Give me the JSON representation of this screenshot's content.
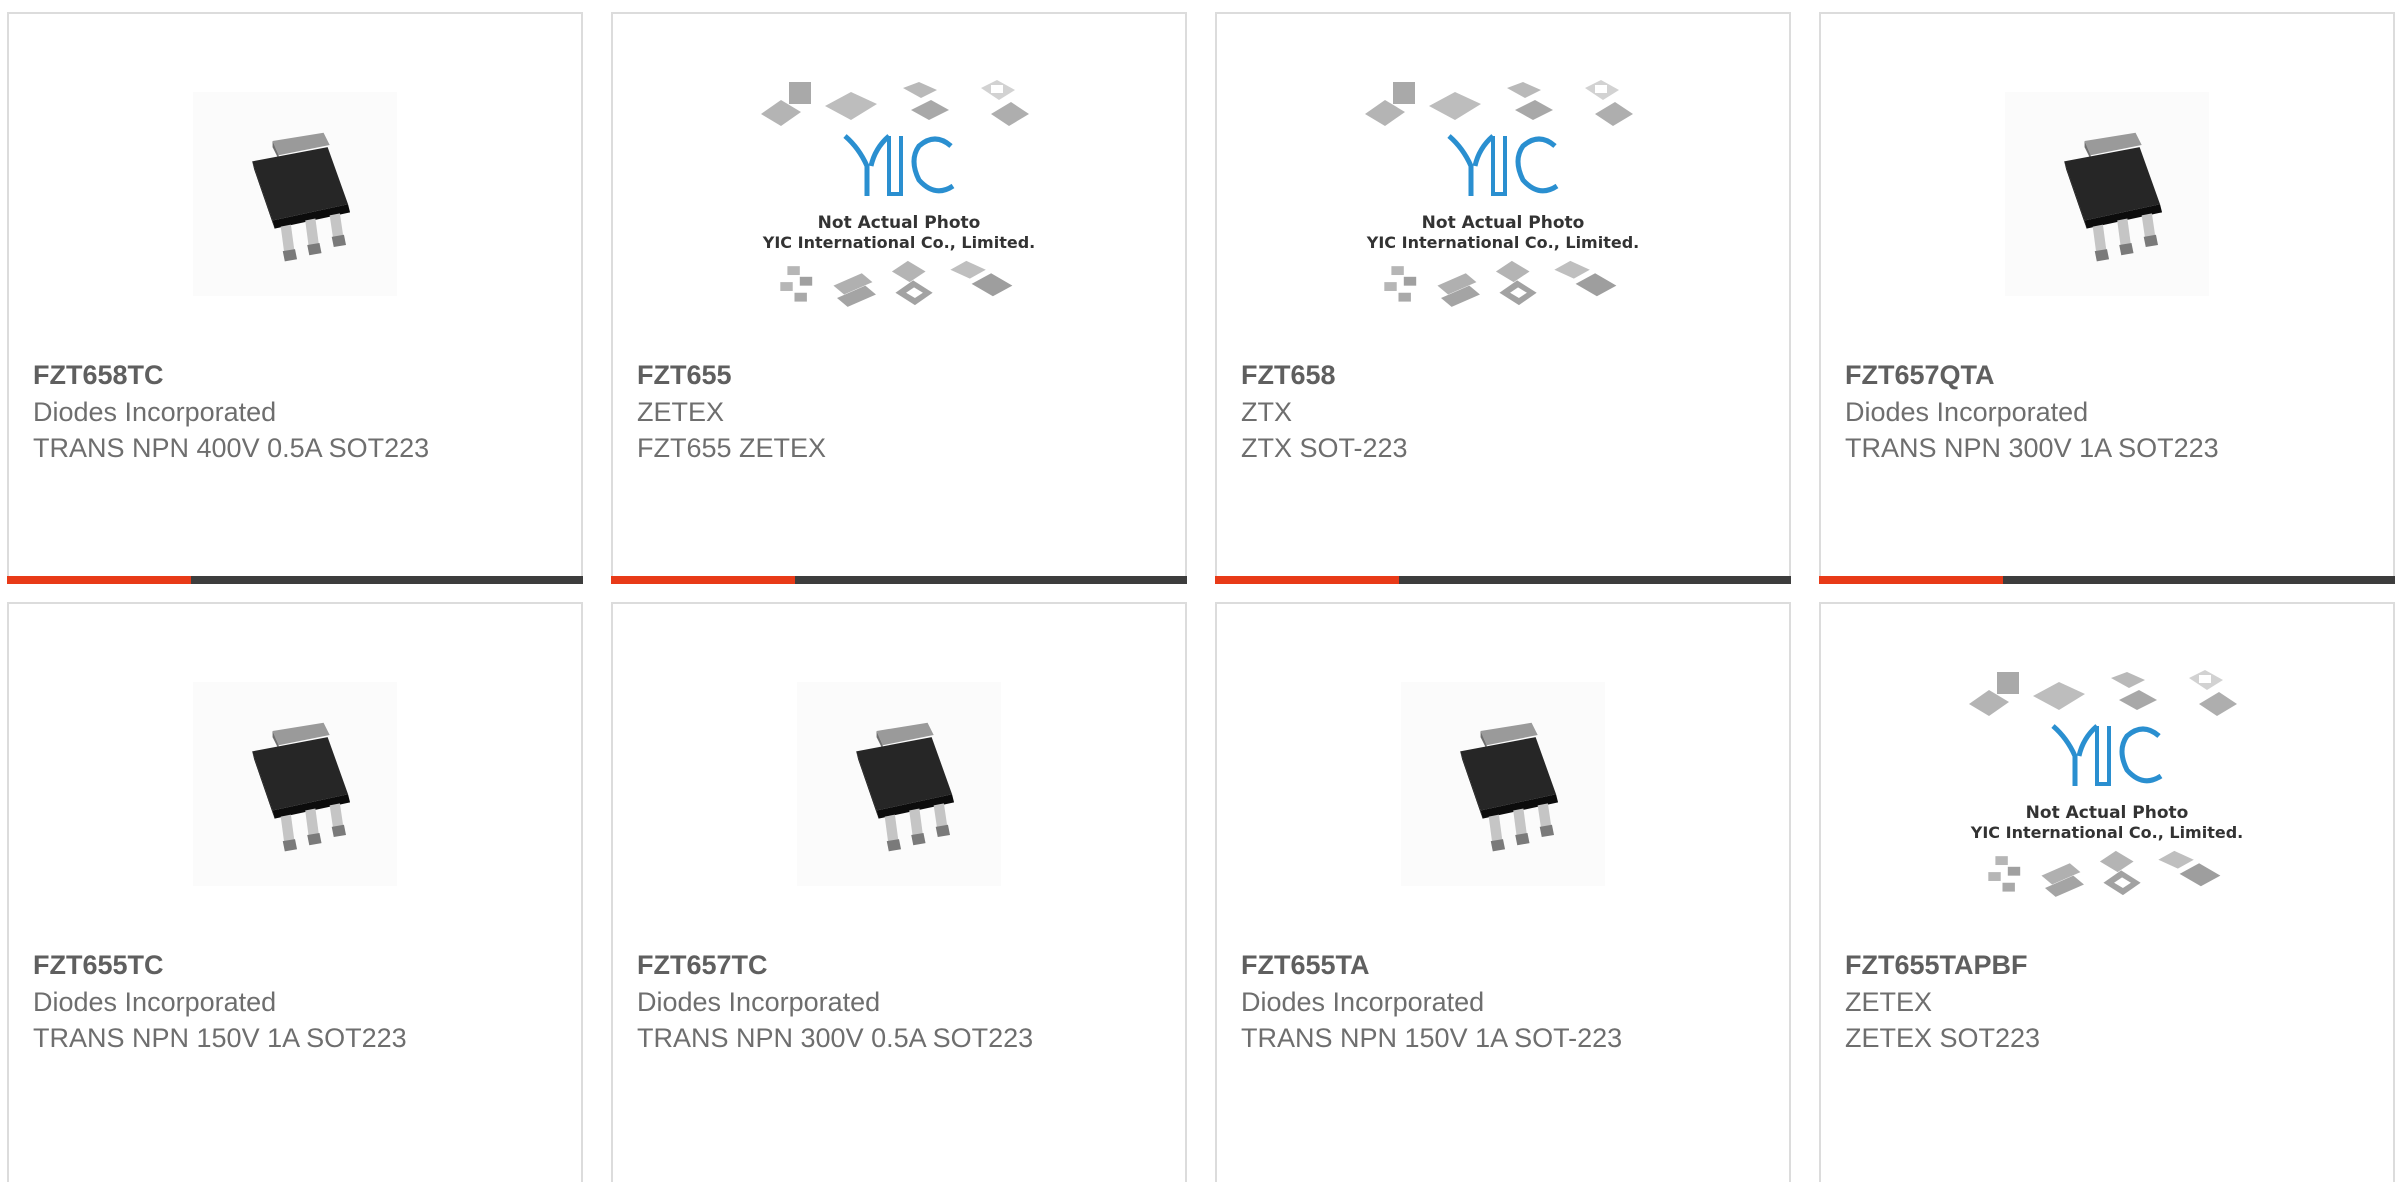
{
  "colors": {
    "accent": "#e83a18",
    "bar": "#3d3d3d",
    "border": "#dcdcdc"
  },
  "placeholder": {
    "line1": "Not Actual Photo",
    "line2": "YIC International Co., Limited.",
    "logo": "YIC"
  },
  "products": [
    {
      "part_number": "FZT658TC",
      "manufacturer": "Diodes Incorporated",
      "description": "TRANS NPN 400V 0.5A SOT223",
      "image": "sot223-photo-icon"
    },
    {
      "part_number": "FZT655",
      "manufacturer": "ZETEX",
      "description": "FZT655 ZETEX",
      "image": "placeholder-photo-icon"
    },
    {
      "part_number": "FZT658",
      "manufacturer": "ZTX",
      "description": "ZTX SOT-223",
      "image": "placeholder-photo-icon"
    },
    {
      "part_number": "FZT657QTA",
      "manufacturer": "Diodes Incorporated",
      "description": "TRANS NPN 300V 1A SOT223",
      "image": "sot223-photo-icon"
    },
    {
      "part_number": "FZT655TC",
      "manufacturer": "Diodes Incorporated",
      "description": "TRANS NPN 150V 1A SOT223",
      "image": "sot223-photo-icon"
    },
    {
      "part_number": "FZT657TC",
      "manufacturer": "Diodes Incorporated",
      "description": "TRANS NPN 300V 0.5A SOT223",
      "image": "sot223-photo-icon"
    },
    {
      "part_number": "FZT655TA",
      "manufacturer": "Diodes Incorporated",
      "description": "TRANS NPN 150V 1A SOT-223",
      "image": "sot223-photo-icon"
    },
    {
      "part_number": "FZT655TAPBF",
      "manufacturer": "ZETEX",
      "description": "ZETEX SOT223",
      "image": "placeholder-photo-icon"
    }
  ]
}
